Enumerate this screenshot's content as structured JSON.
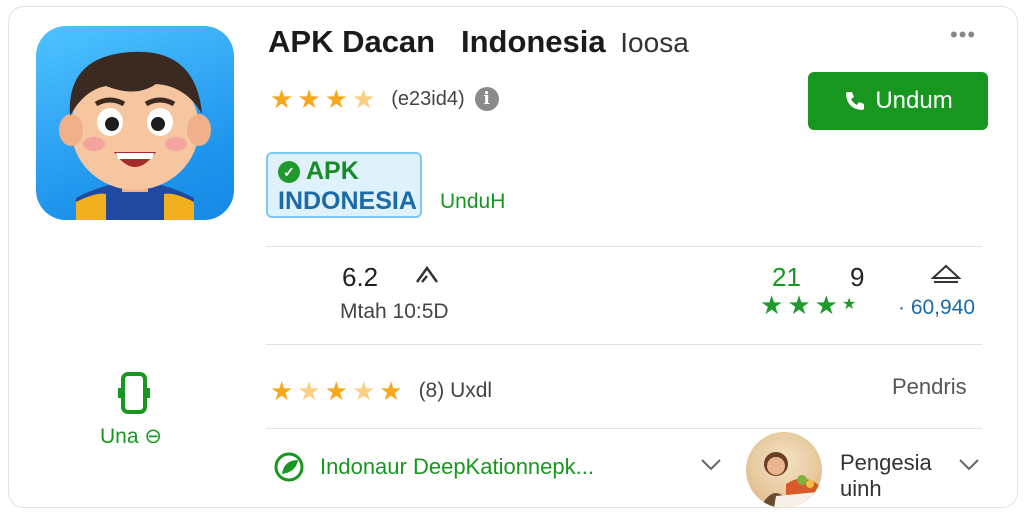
{
  "app": {
    "title": "APK Dacan",
    "title_main": "Indonesia",
    "title_sub": "Ioosa",
    "rating_count": "(e23id4)",
    "install_label": "Undum",
    "badge_line1": "APK",
    "badge_line2": "INDONESIA",
    "badge_side_text": "UnduH"
  },
  "stats": {
    "left_value": "6.2",
    "left_label": "Mtah 10:5D",
    "right_value_a": "21",
    "right_value_b": "9",
    "right_count": "60,940"
  },
  "review_row": {
    "count": "(8) Uxdl",
    "right_label": "Pendris"
  },
  "side": {
    "label": "Una"
  },
  "bottom_row": {
    "text": "Indonaur DeepKationnepk...",
    "right_line1": "Pengesia",
    "right_line2": "uinh"
  },
  "colors": {
    "accent_green": "#17971f",
    "star_orange": "#f7a81b",
    "badge_blue": "#1c6aa8"
  }
}
